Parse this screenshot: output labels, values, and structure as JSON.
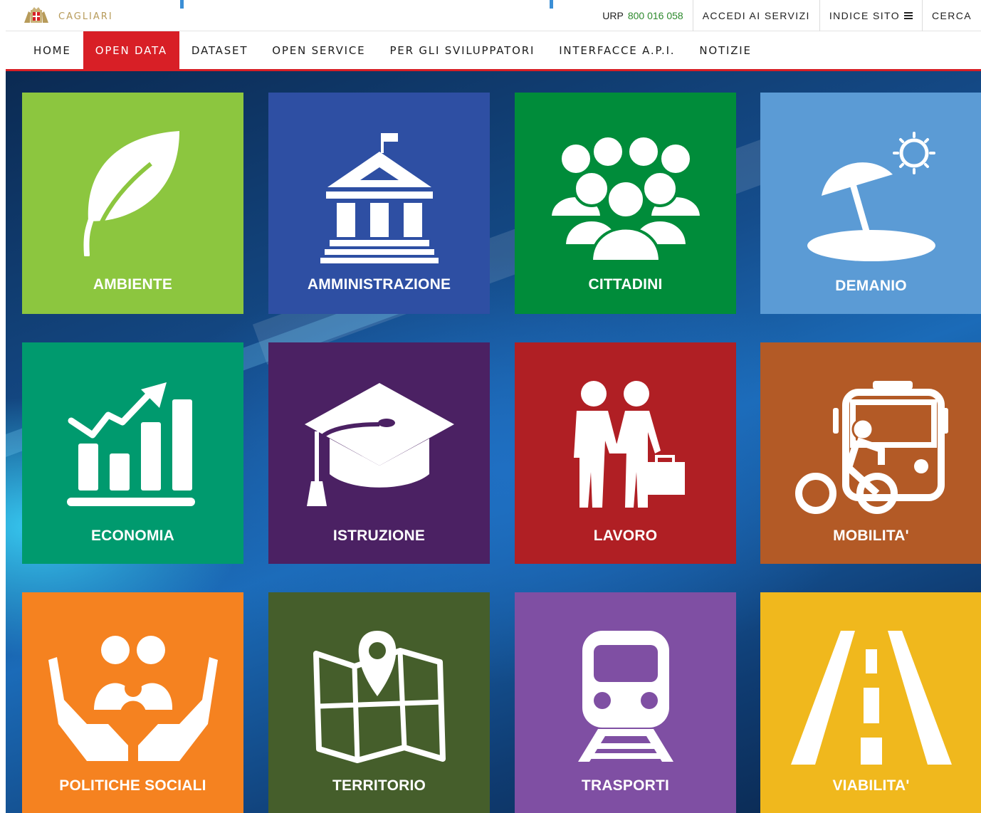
{
  "utility_bar": {
    "brand_name": "CAGLIARI",
    "urp_label": "URP",
    "urp_number": "800 016 058",
    "links": [
      "ACCEDI AI SERVIZI",
      "INDICE SITO",
      "CERCA"
    ]
  },
  "main_nav": {
    "items": [
      "HOME",
      "OPEN DATA",
      "DATASET",
      "OPEN SERVICE",
      "PER GLI SVILUPPATORI",
      "INTERFACCE A.P.I.",
      "NOTIZIE"
    ],
    "active": "OPEN DATA"
  },
  "tiles": [
    {
      "label": "AMBIENTE",
      "icon": "leaf-icon",
      "color": "#8cc63f"
    },
    {
      "label": "AMMINISTRAZIONE",
      "icon": "city-hall-icon",
      "color": "#2e4fa3"
    },
    {
      "label": "CITTADINI",
      "icon": "crowd-icon",
      "color": "#008c3a"
    },
    {
      "label": "DEMANIO",
      "icon": "beach-umbrella-icon",
      "color": "#5b9bd5"
    },
    {
      "label": "ECONOMIA",
      "icon": "growth-chart-icon",
      "color": "#009a6e"
    },
    {
      "label": "ISTRUZIONE",
      "icon": "graduation-cap-icon",
      "color": "#4b2163"
    },
    {
      "label": "LAVORO",
      "icon": "handshake-icon",
      "color": "#b01f24"
    },
    {
      "label": "MOBILITA'",
      "icon": "bus-bicycle-icon",
      "color": "#b35a26"
    },
    {
      "label": "POLITICHE SOCIALI",
      "icon": "family-hands-icon",
      "color": "#f58220"
    },
    {
      "label": "TERRITORIO",
      "icon": "map-pin-icon",
      "color": "#455e2b"
    },
    {
      "label": "TRASPORTI",
      "icon": "train-icon",
      "color": "#7f4fa3"
    },
    {
      "label": "VIABILITA'",
      "icon": "road-icon",
      "color": "#f0b81d"
    }
  ]
}
